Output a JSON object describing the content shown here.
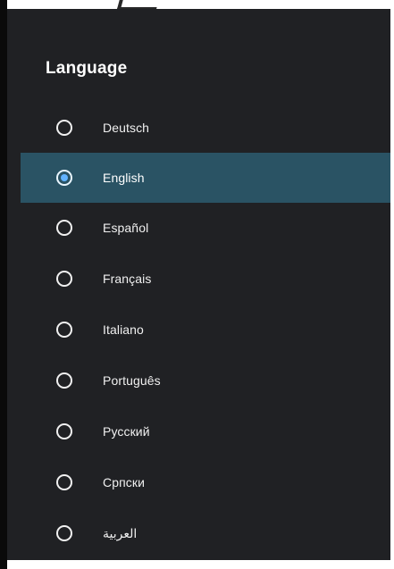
{
  "screen": {
    "title": "Language"
  },
  "languages": [
    {
      "label": "Deutsch",
      "selected": false
    },
    {
      "label": "English",
      "selected": true
    },
    {
      "label": "Español",
      "selected": false
    },
    {
      "label": "Français",
      "selected": false
    },
    {
      "label": "Italiano",
      "selected": false
    },
    {
      "label": "Português",
      "selected": false
    },
    {
      "label": "Русский",
      "selected": false
    },
    {
      "label": "Српски",
      "selected": false
    },
    {
      "label": "العربية",
      "selected": false
    }
  ],
  "colors": {
    "panel_bg": "#202124",
    "selected_row_bg": "#2a5364",
    "radio_dot": "#62b3ff",
    "text": "#f0f0f0"
  },
  "icons": {
    "radio_unselected": "radio-unselected-icon",
    "radio_selected": "radio-selected-icon"
  }
}
